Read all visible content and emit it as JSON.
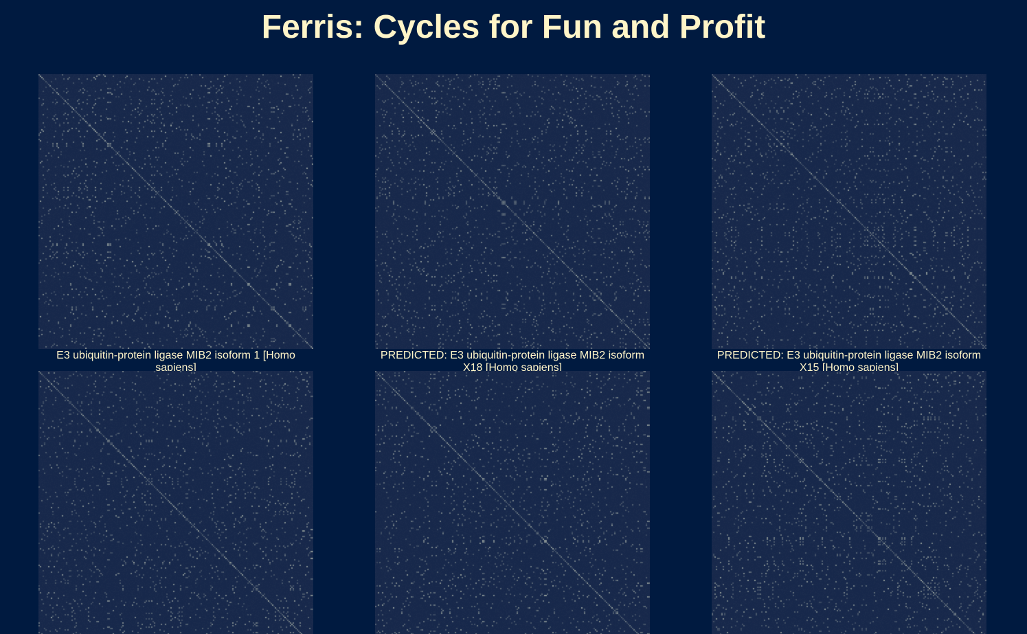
{
  "page": {
    "title": "Ferris: Cycles for Fun and Profit"
  },
  "colors": {
    "background": "#001a40",
    "title_text": "#fff5c8",
    "plot_base": "#17284b",
    "plot_light": "#ccd3c0"
  },
  "plots": [
    {
      "caption": "E3 ubiquitin-protein ligase MIB2 isoform 1 [Homo sapiens]"
    },
    {
      "caption": "PREDICTED: E3 ubiquitin-protein ligase MIB2 isoform X18 [Homo sapiens]"
    },
    {
      "caption": "PREDICTED: E3 ubiquitin-protein ligase MIB2 isoform X15 [Homo sapiens]"
    },
    {
      "caption": ""
    },
    {
      "caption": ""
    },
    {
      "caption": ""
    }
  ]
}
